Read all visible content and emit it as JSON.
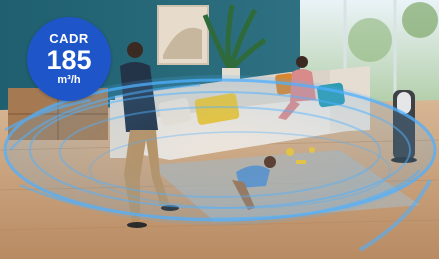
{
  "badge": {
    "label": "CADR",
    "value": "185",
    "unit": "m³/h",
    "color": "#1e56c9"
  },
  "scene": {
    "wall_color": "#2d6d7d",
    "floor_color": "#c89f7a",
    "sofa_color": "#ece4db",
    "airflow_color": "#4fb0ff"
  }
}
